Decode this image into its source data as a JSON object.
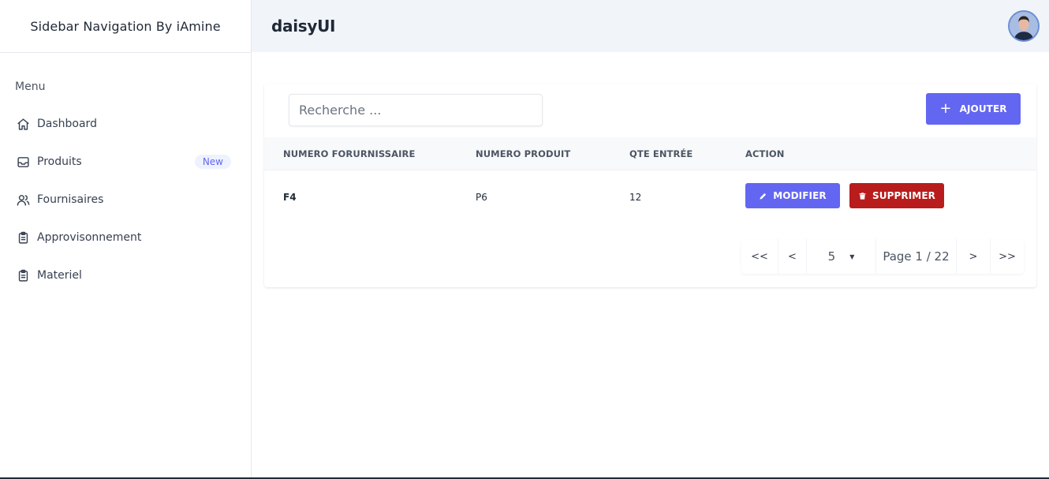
{
  "sidebar": {
    "brand": "Sidebar Navigation By iAmine",
    "menu_heading": "Menu",
    "items": [
      {
        "label": "Dashboard",
        "icon": "home-icon"
      },
      {
        "label": "Produits",
        "icon": "inbox-icon",
        "badge": "New"
      },
      {
        "label": "Fournisaires",
        "icon": "users-icon"
      },
      {
        "label": "Approvisonnement",
        "icon": "clipboard-icon"
      },
      {
        "label": "Materiel",
        "icon": "clipboard-icon"
      }
    ]
  },
  "header": {
    "title": "daisyUI",
    "avatar": "user-avatar"
  },
  "toolbar": {
    "search_placeholder": "Recherche ...",
    "add_label": "AJOUTER"
  },
  "table": {
    "columns": [
      "NUMERO FORURNISSAIRE",
      "NUMERO PRODUIT",
      "QTE ENTRÉE",
      "ACTION"
    ],
    "rows": [
      {
        "fournisseur": "F4",
        "produit": "P6",
        "qte": "12",
        "edit_label": "MODIFIER",
        "delete_label": "SUPPRIMER"
      }
    ]
  },
  "pagination": {
    "first": "<<",
    "prev": "<",
    "page_size": "5",
    "page_label": "Page 1 / 22",
    "next": ">",
    "last": ">>"
  },
  "colors": {
    "accent": "#6366f1",
    "danger": "#b91c1c",
    "header_bg": "#f1f4f9"
  }
}
